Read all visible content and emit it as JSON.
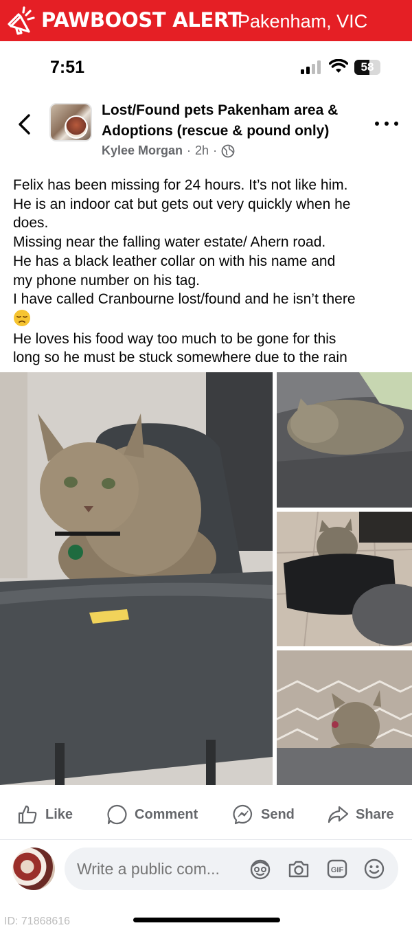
{
  "alert": {
    "title": "PAWBOOST ALERT",
    "location": "Pakenham, VIC",
    "icon": "megaphone-icon",
    "bg_color": "#e51f25"
  },
  "status_bar": {
    "time": "7:51",
    "battery_level": "58",
    "battery_fraction": 0.58
  },
  "post": {
    "group_name_line1": "Lost/Found pets Pakenham area &",
    "group_name_line2": "Adoptions (rescue & pound only)",
    "author": "Kylee Morgan",
    "time": "2h",
    "separator": "·",
    "lines": [
      "Felix has been missing for 24 hours. It’s not like him.",
      "He is an indoor cat but gets out very quickly when he",
      "does.",
      "Missing near the falling water estate/ Ahern road.",
      "He has a black leather collar on with his name and",
      "my phone number on his tag.",
      "I have called Cranbourne lost/found and he isn’t there",
      "He loves his food way too much to be gone for this",
      "long so he must be stuck somewhere due to the rain"
    ],
    "emoji": "sad-face-emoji"
  },
  "actions": {
    "like": "Like",
    "comment": "Comment",
    "send": "Send",
    "share": "Share"
  },
  "composer": {
    "placeholder": "Write a public com..."
  },
  "footer": {
    "id": "ID: 71868616"
  }
}
